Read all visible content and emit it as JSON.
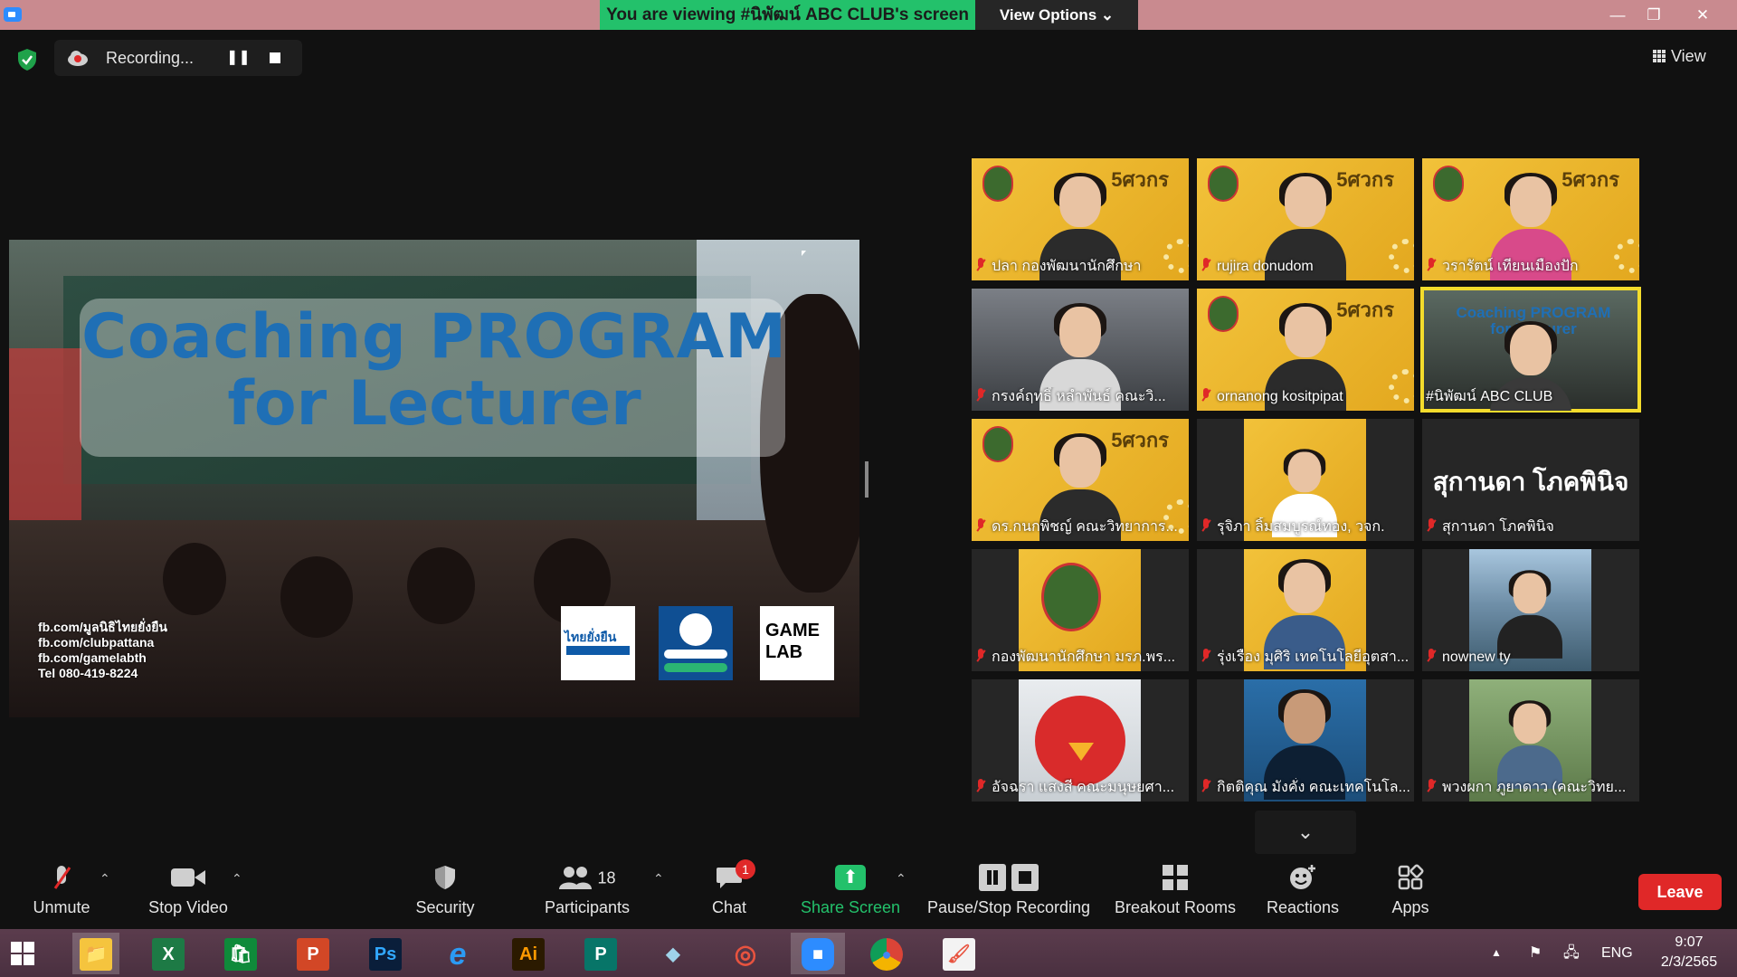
{
  "titlebar": {
    "banner_text": "You are viewing #นิพัฒน์ ABC CLUB's screen",
    "view_options_label": "View Options",
    "minimize_glyph": "—",
    "restore_glyph": "❐",
    "close_glyph": "✕"
  },
  "topbar": {
    "recording_label": "Recording...",
    "view_label": "View"
  },
  "shared_screen": {
    "title_line1": "Coaching PROGRAM",
    "title_line2": "for Lecturer",
    "contacts": [
      "fb.com/มูลนิธิไทยยั่งยืน",
      "fb.com/clubpattana",
      "fb.com/gamelabth",
      "Tel 080-419-8224"
    ],
    "logo1_text": "ไทยยั่งยืน",
    "logo3_line1": "GAME",
    "logo3_line2": "LAB"
  },
  "gallery": {
    "badge_text": "5ศวกร",
    "active_tile_title": "Coaching PROGRAM for Lecturer",
    "big_name": "สุกานดา โภคพินิจ",
    "participants": [
      "ปลา กองพัฒนานักศึกษา",
      "rujira donudom",
      "วรารัตน์ เทียนเมืองปัก",
      "กรงค์ฤทธิ์ หลำพันธ์ คณะวิ...",
      "ornanong kositpipat",
      "#นิพัฒน์ ABC CLUB",
      "ดร.กนกพิชญ์ คณะวิทยาการ...",
      "รุจิภา ลิ้มสมบูรณ์ทอง, วจก.",
      "สุกานดา โภคพินิจ",
      "กองพัฒนานักศึกษา มรภ.พร...",
      "รุ่งเรือง มุศิริ เทคโนโลยีอุตสา...",
      "nownew ty",
      "อัจฉรา แสงสี คณะมนุษยศา...",
      "กิตติคุณ มังคั่ง คณะเทคโนโล...",
      "พวงผกา ภูยาดาว (คณะวิทย..."
    ]
  },
  "toolbar": {
    "unmute": "Unmute",
    "stop_video": "Stop Video",
    "security": "Security",
    "participants": "Participants",
    "participants_count": "18",
    "chat": "Chat",
    "chat_badge": "1",
    "share_screen": "Share Screen",
    "pause_stop_recording": "Pause/Stop Recording",
    "breakout_rooms": "Breakout Rooms",
    "reactions": "Reactions",
    "apps": "Apps",
    "leave": "Leave"
  },
  "taskbar": {
    "apps": [
      {
        "name": "file-explorer",
        "glyph": "📁"
      },
      {
        "name": "excel",
        "glyph": "X"
      },
      {
        "name": "store",
        "glyph": "🛍"
      },
      {
        "name": "powerpoint",
        "glyph": "P"
      },
      {
        "name": "photoshop",
        "glyph": "Ps"
      },
      {
        "name": "internet-explorer",
        "glyph": "e"
      },
      {
        "name": "illustrator",
        "glyph": "Ai"
      },
      {
        "name": "publisher",
        "glyph": "P"
      },
      {
        "name": "eraser",
        "glyph": "◆"
      },
      {
        "name": "photoscape",
        "glyph": "◎"
      },
      {
        "name": "zoom",
        "glyph": "■"
      },
      {
        "name": "chrome",
        "glyph": "●"
      },
      {
        "name": "paint",
        "glyph": "🖌"
      }
    ],
    "language": "ENG",
    "time": "9:07",
    "date": "2/3/2565"
  },
  "colors": {
    "banner_green": "#23c16b",
    "leave_red": "#e02828",
    "active_speaker_outline": "#f4dc2c",
    "titlebar_pink": "#c98a8f"
  }
}
